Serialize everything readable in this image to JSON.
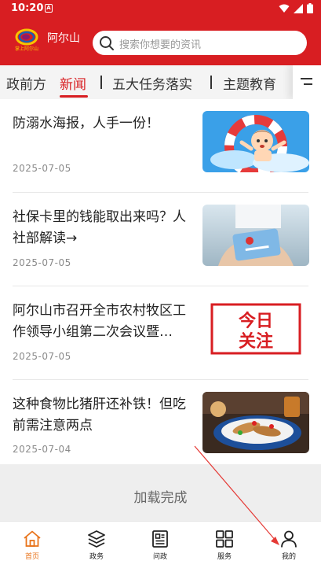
{
  "status": {
    "time": "10:20",
    "sim_label": "A"
  },
  "header": {
    "city": "阿尔山",
    "logo_text": "掌上阿尔山",
    "search_placeholder": "搜索你想要的资讯"
  },
  "tabs": [
    {
      "label": "政前方"
    },
    {
      "label": "新闻"
    },
    {
      "label": "五大任务落实"
    },
    {
      "label": "主题教育"
    }
  ],
  "news": [
    {
      "title": "防溺水海报，人手一份！",
      "date": "2025-07-05",
      "thumb": "drowning-poster"
    },
    {
      "title": "社保卡里的钱能取出来吗？人社部解读→",
      "date": "2025-07-05",
      "thumb": "social-security-card"
    },
    {
      "title": "阿尔山市召开全市农村牧区工作领导小组第二次会议暨…",
      "date": "2025-07-05",
      "thumb": "today-focus",
      "thumb_text": "今日关注"
    },
    {
      "title": "这种食物比猪肝还补铁！但吃前需注意两点",
      "date": "2025-07-04",
      "thumb": "food-dish"
    }
  ],
  "load_status": "加载完成",
  "bottom_nav": [
    {
      "label": "首页",
      "icon": "home-icon",
      "active": true
    },
    {
      "label": "政务",
      "icon": "layers-icon",
      "active": false
    },
    {
      "label": "问政",
      "icon": "newspaper-icon",
      "active": false
    },
    {
      "label": "服务",
      "icon": "grid-icon",
      "active": false
    },
    {
      "label": "我的",
      "icon": "user-icon",
      "active": false
    }
  ],
  "colors": {
    "brand_red": "#d81e22",
    "active_nav": "#e8731a",
    "date_gray": "#8a8a8a"
  }
}
